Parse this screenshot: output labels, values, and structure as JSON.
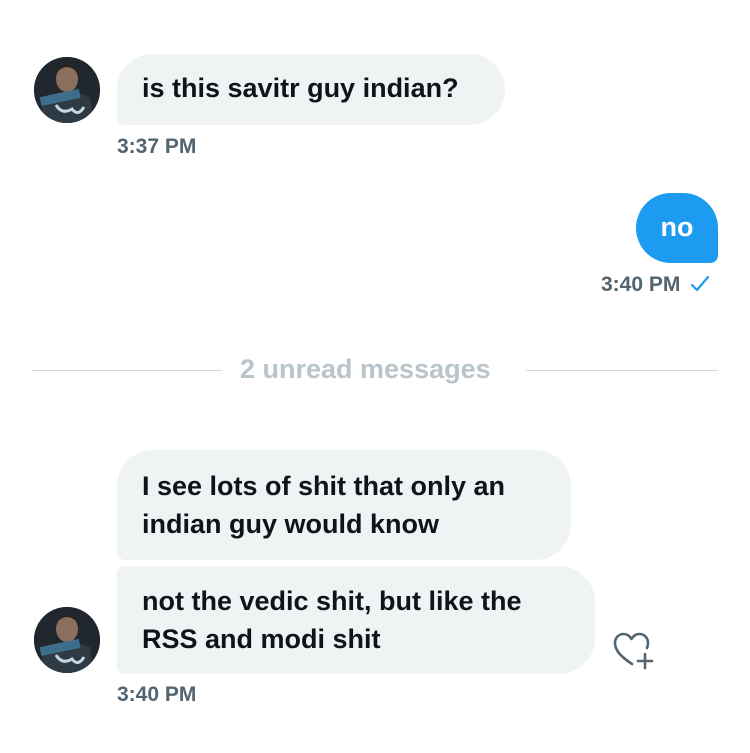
{
  "conversation": {
    "messages": [
      {
        "from": "other",
        "text": "is this savitr guy indian?",
        "time": "3:37 PM"
      },
      {
        "from": "me",
        "text": "no",
        "time": "3:40 PM",
        "status": "read-check"
      },
      {
        "from": "other",
        "text": "I see lots of shit that only an indian guy would know"
      },
      {
        "from": "other",
        "text": "not the vedic shit, but like the RSS and modi shit",
        "time": "3:40 PM"
      }
    ],
    "unread_divider": "2 unread messages"
  },
  "colors": {
    "accent": "#1d9bf0",
    "incoming_bubble": "#eff3f4",
    "timestamp": "#536471",
    "divider_text": "#b9c4cb"
  },
  "icons": {
    "read_receipt": "checkmark-icon",
    "reaction": "heart-plus-icon"
  }
}
